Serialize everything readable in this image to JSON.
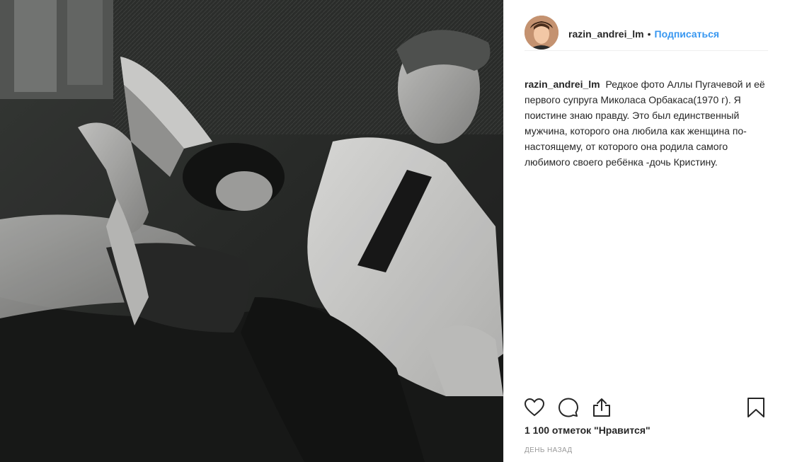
{
  "post": {
    "username": "razin_andrei_lm",
    "separator": "•",
    "follow_label": "Подписаться",
    "caption": "Редкое фото Аллы Пугачевой и её первого супруга Миколаса Орбакаса(1970 г). Я поистине знаю правду. Это был единственный мужчина, которого она любила как женщина по-настоящему, от которого она родила самого любимого своего ребёнка -дочь Кристину.",
    "likes": "1 100 отметок \"Нравится\"",
    "timestamp": "ДЕНЬ НАЗАД"
  },
  "icons": {
    "like": "heart-icon",
    "comment": "comment-bubble-icon",
    "share": "share-upload-icon",
    "save": "bookmark-icon"
  },
  "colors": {
    "link": "#3897f0",
    "text": "#262626",
    "muted": "#999999",
    "border": "#efefef"
  }
}
